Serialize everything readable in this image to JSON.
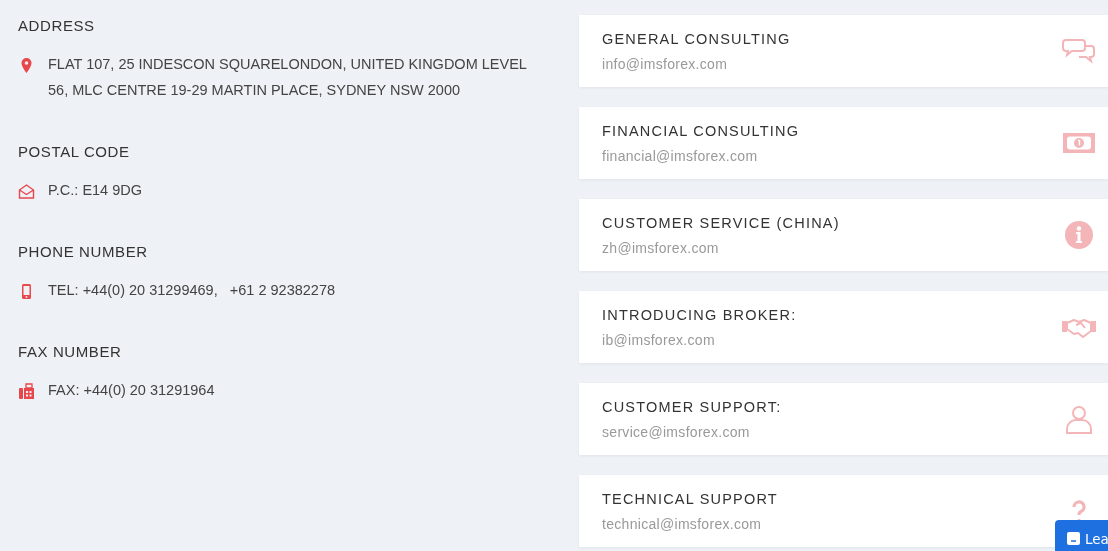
{
  "sections": [
    {
      "heading": "ADDRESS",
      "lines": [
        "FLAT 107, 25 INDESCON SQUARELONDON, UNITED KINGDOM LEVEL 56, MLC CENTRE 19-29 MARTIN PLACE, SYDNEY NSW 2000"
      ]
    },
    {
      "heading": "POSTAL CODE",
      "lines": [
        "P.C.: E14 9DG"
      ]
    },
    {
      "heading": "PHONE NUMBER",
      "lines": [
        "TEL: +44(0) 20 31299469,   +61 2 92382278"
      ]
    },
    {
      "heading": "FAX NUMBER",
      "lines": [
        "FAX: +44(0) 20 31291964"
      ]
    }
  ],
  "contacts": [
    {
      "title": "GENERAL CONSULTING",
      "email": "info@imsforex.com"
    },
    {
      "title": "FINANCIAL CONSULTING",
      "email": "financial@imsforex.com"
    },
    {
      "title": "CUSTOMER SERVICE (CHINA)",
      "email": "zh@imsforex.com"
    },
    {
      "title": "INTRODUCING BROKER:",
      "email": "ib@imsforex.com"
    },
    {
      "title": "CUSTOMER SUPPORT:",
      "email": "service@imsforex.com"
    },
    {
      "title": "TECHNICAL SUPPORT",
      "email": "technical@imsforex.com"
    }
  ],
  "chat_button": {
    "label": "Lea"
  }
}
